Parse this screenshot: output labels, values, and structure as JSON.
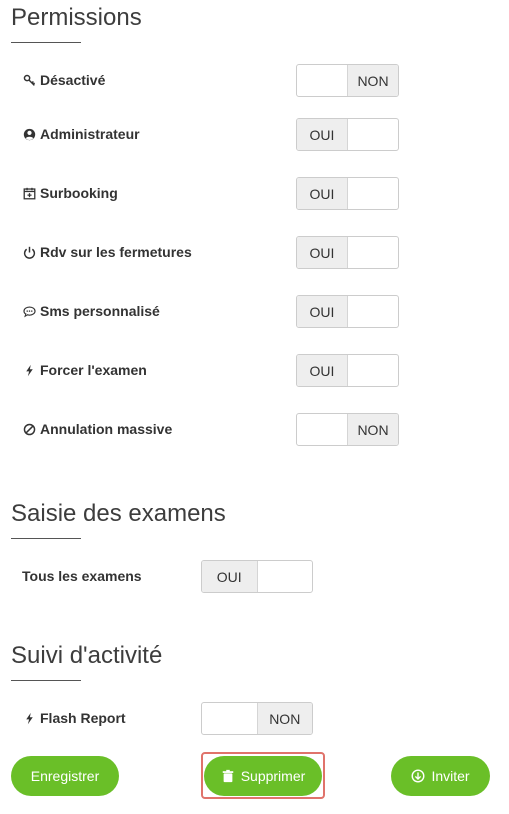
{
  "sections": {
    "permissions": {
      "title": "Permissions",
      "items": [
        {
          "label": "Désactivé",
          "icon": "key-icon",
          "state": "NON"
        },
        {
          "label": "Administrateur",
          "icon": "user-circle-icon",
          "state": "OUI"
        },
        {
          "label": "Surbooking",
          "icon": "calendar-plus-icon",
          "state": "OUI"
        },
        {
          "label": "Rdv sur les fermetures",
          "icon": "power-icon",
          "state": "OUI"
        },
        {
          "label": "Sms personnalisé",
          "icon": "comment-icon",
          "state": "OUI"
        },
        {
          "label": "Forcer l'examen",
          "icon": "bolt-icon",
          "state": "OUI"
        },
        {
          "label": "Annulation massive",
          "icon": "ban-icon",
          "state": "NON"
        }
      ]
    },
    "exams": {
      "title": "Saisie des examens",
      "items": [
        {
          "label": "Tous les examens",
          "state": "OUI"
        }
      ]
    },
    "activity": {
      "title": "Suivi d'activité",
      "items": [
        {
          "label": "Flash Report",
          "icon": "bolt-icon",
          "state": "NON"
        }
      ]
    }
  },
  "buttons": {
    "save": {
      "label": "Enregistrer"
    },
    "delete": {
      "label": "Supprimer",
      "icon": "trash-icon"
    },
    "invite": {
      "label": "Inviter",
      "icon": "download-circle-icon"
    }
  },
  "colors": {
    "accent": "#6abf28",
    "focus": "#e0736b",
    "toggle_fill": "#eeeeee"
  }
}
